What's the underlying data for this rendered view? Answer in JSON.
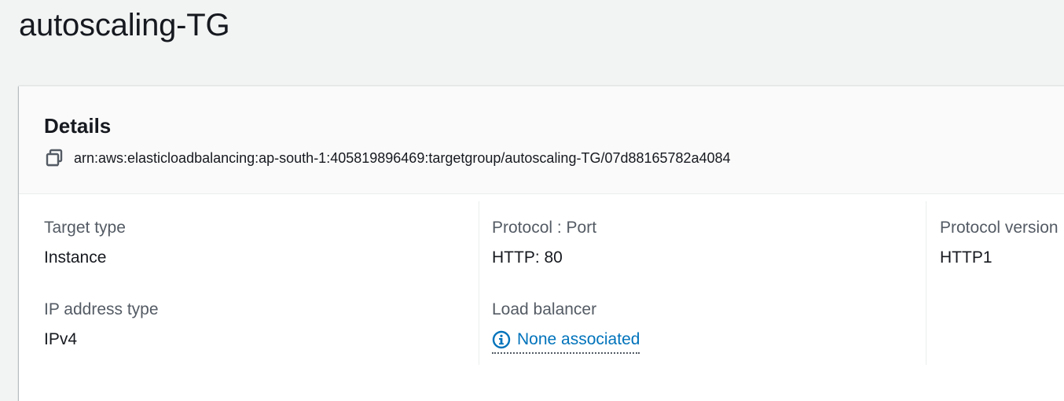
{
  "page": {
    "title": "autoscaling-TG"
  },
  "details": {
    "heading": "Details",
    "arn": "arn:aws:elasticloadbalancing:ap-south-1:405819896469:targetgroup/autoscaling-TG/07d88165782a4084",
    "fields": {
      "target_type": {
        "label": "Target type",
        "value": "Instance"
      },
      "ip_address_type": {
        "label": "IP address type",
        "value": "IPv4"
      },
      "protocol_port": {
        "label": "Protocol : Port",
        "value": "HTTP: 80"
      },
      "load_balancer": {
        "label": "Load balancer",
        "value": "None associated"
      },
      "protocol_version": {
        "label": "Protocol version",
        "value": "HTTP1"
      }
    }
  },
  "icons": {
    "copy": "copy-icon",
    "info": "info-icon"
  },
  "colors": {
    "link": "#0073bb",
    "label": "#545b64",
    "text": "#16191f",
    "background": "#f2f3f3"
  }
}
